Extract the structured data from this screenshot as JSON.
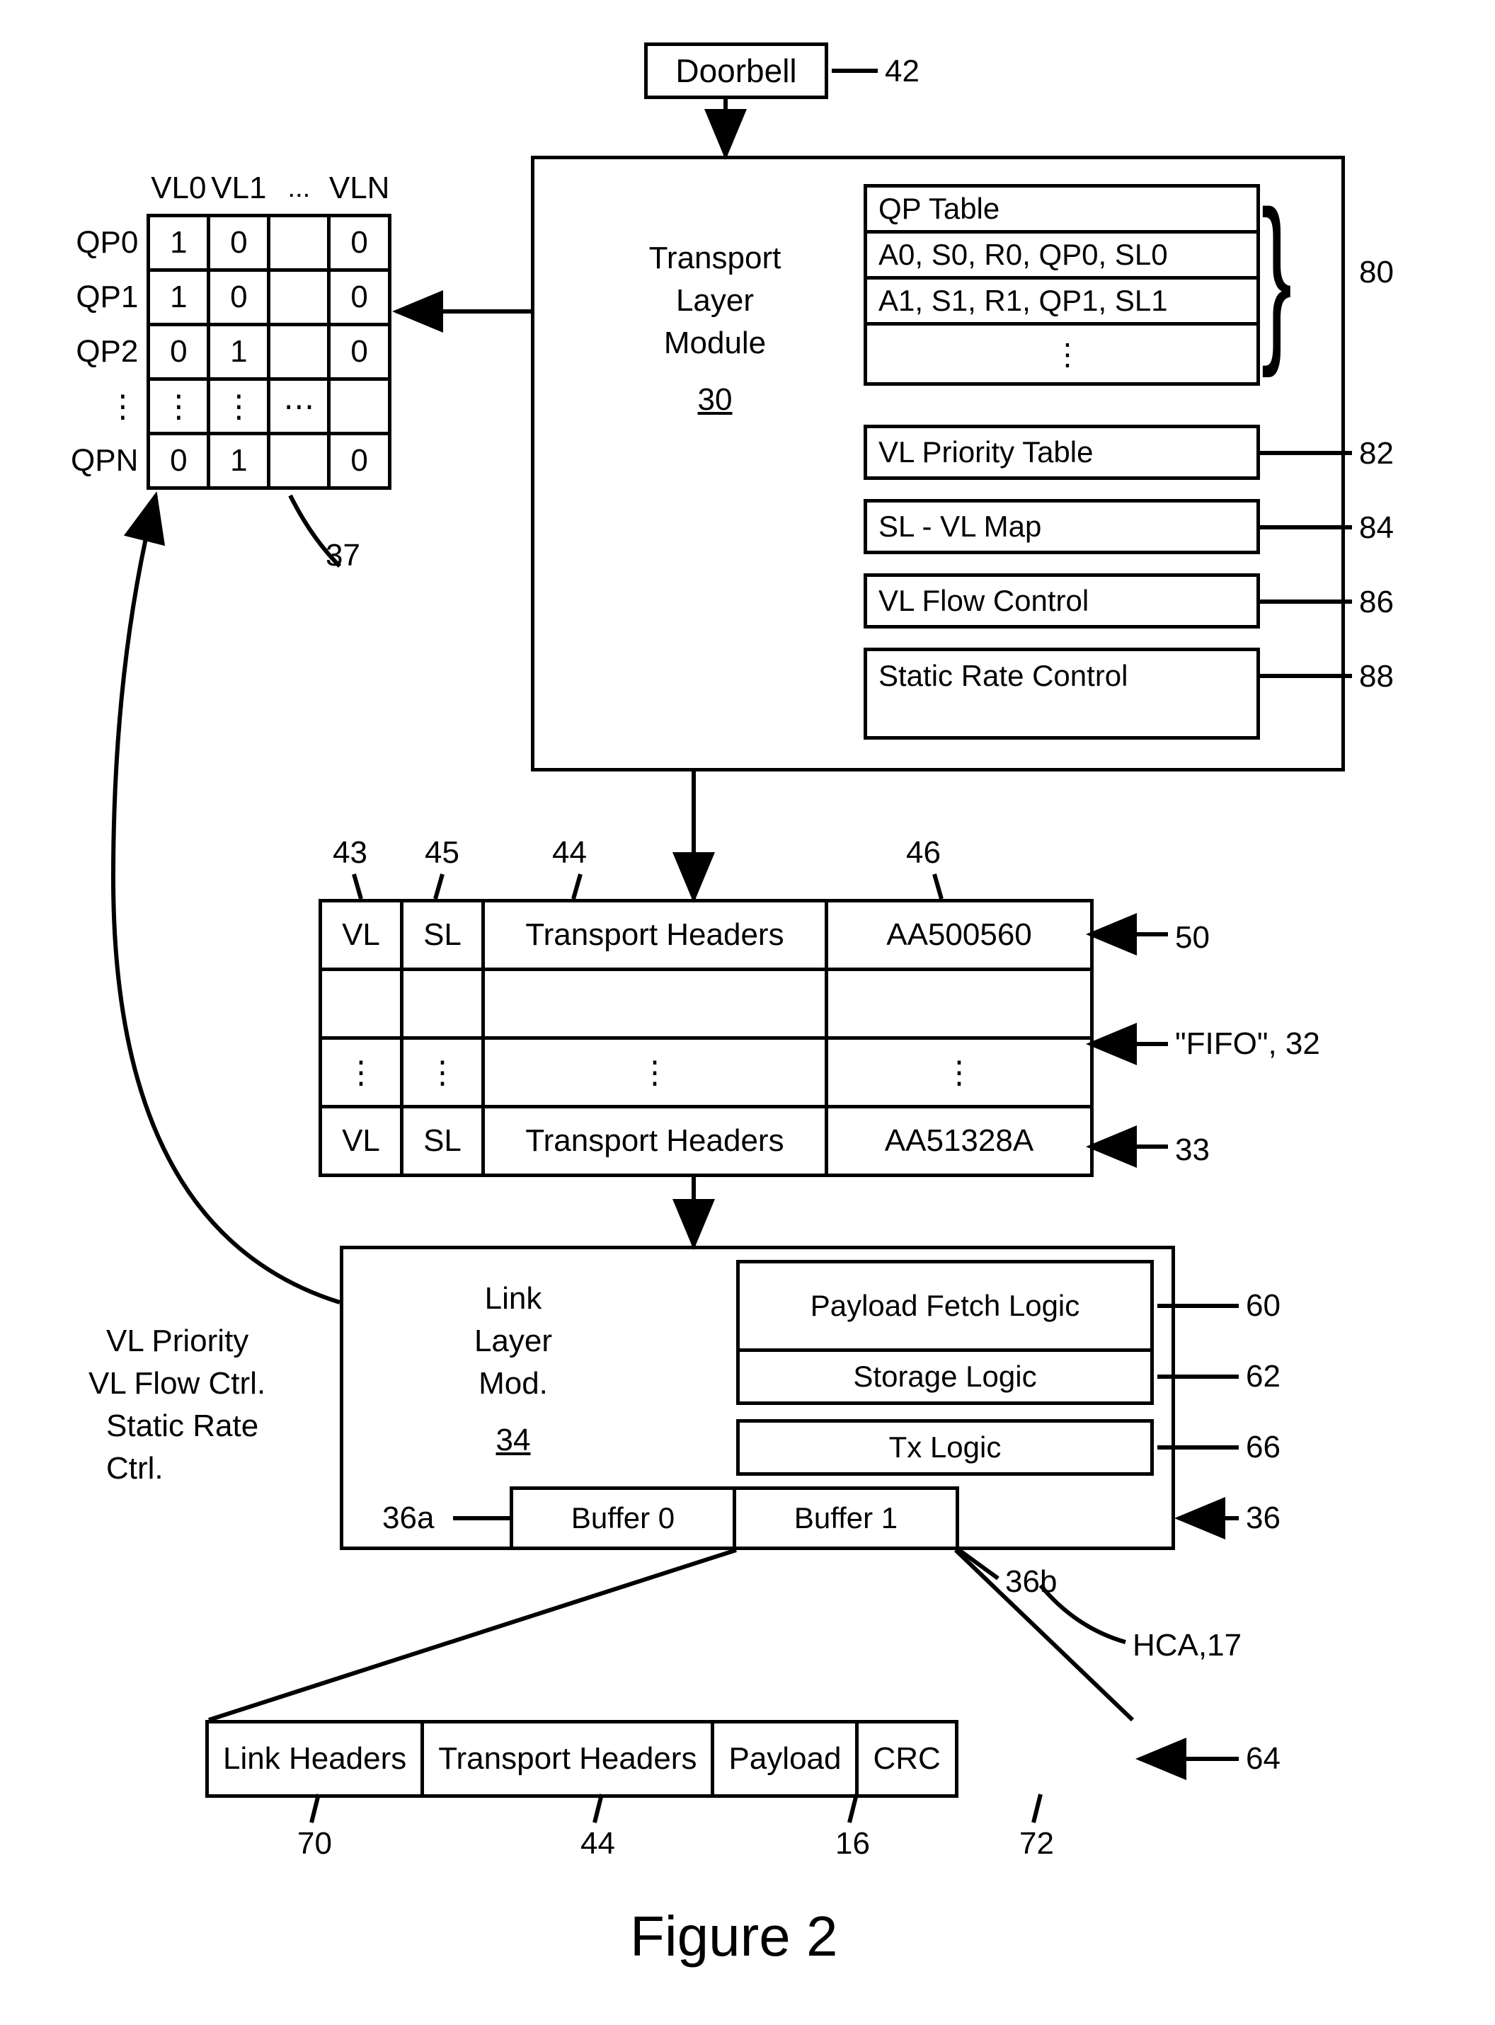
{
  "doorbell": {
    "label": "Doorbell",
    "ref": "42"
  },
  "transport_module": {
    "title1": "Transport",
    "title2": "Layer",
    "title3": "Module",
    "ref": "30"
  },
  "qp_matrix": {
    "ref": "37",
    "col_headers": [
      "VL0",
      "VL1",
      "...",
      "VLN"
    ],
    "rows": [
      {
        "label": "QP0",
        "cells": [
          "1",
          "0",
          "",
          "0"
        ]
      },
      {
        "label": "QP1",
        "cells": [
          "1",
          "0",
          "",
          "0"
        ]
      },
      {
        "label": "QP2",
        "cells": [
          "0",
          "1",
          "",
          "0"
        ]
      },
      {
        "label": "⋮",
        "cells": [
          "⋮",
          "⋮",
          "⋯",
          ""
        ]
      },
      {
        "label": "QPN",
        "cells": [
          "0",
          "1",
          "",
          "0"
        ]
      }
    ]
  },
  "tables": {
    "qp_table": {
      "title": "QP Table",
      "rows": [
        "A0, S0, R0, QP0, SL0",
        "A1, S1, R1, QP1, SL1",
        "⋮"
      ],
      "ref": "80"
    },
    "vl_priority": {
      "label": "VL Priority Table",
      "ref": "82"
    },
    "sl_vl_map": {
      "label": "SL - VL Map",
      "ref": "84"
    },
    "vl_flow": {
      "label": "VL Flow Control",
      "ref": "86"
    },
    "static_rate": {
      "label": "Static Rate Control",
      "ref": "88"
    }
  },
  "fifo": {
    "ref_group": "\"FIFO\", 32",
    "ref_top": "50",
    "ref_bottom": "33",
    "col_refs": {
      "vl": "43",
      "sl": "45",
      "th": "44",
      "addr": "46"
    },
    "rows": [
      {
        "vl": "VL",
        "sl": "SL",
        "th": "Transport Headers",
        "addr": "AA500560"
      },
      {
        "vl": "",
        "sl": "",
        "th": "",
        "addr": ""
      },
      {
        "vl": "⋮",
        "sl": "⋮",
        "th": "⋮",
        "addr": "⋮"
      },
      {
        "vl": "VL",
        "sl": "SL",
        "th": "Transport Headers",
        "addr": "AA51328A"
      }
    ]
  },
  "link_module": {
    "title1": "Link",
    "title2": "Layer",
    "title3": "Mod.",
    "ref": "34",
    "side_label1": "VL Priority",
    "side_label2": "VL Flow Ctrl.",
    "side_label3": "Static Rate",
    "side_label4": "Ctrl.",
    "payload_fetch": {
      "label": "Payload Fetch Logic",
      "ref": "60"
    },
    "storage": {
      "label": "Storage Logic",
      "ref": "62"
    },
    "tx": {
      "label": "Tx Logic",
      "ref": "66"
    },
    "buffers": {
      "b0": "Buffer 0",
      "b1": "Buffer 1",
      "ref0": "36a",
      "ref1": "36b",
      "ref_group": "36"
    },
    "hca_ref": "HCA,17"
  },
  "packet": {
    "ref": "64",
    "cells": [
      {
        "label": "Link Headers",
        "ref": "70"
      },
      {
        "label": "Transport Headers",
        "ref": "44"
      },
      {
        "label": "Payload",
        "ref": "16"
      },
      {
        "label": "CRC",
        "ref": "72"
      }
    ]
  },
  "figure_label": "Figure 2"
}
